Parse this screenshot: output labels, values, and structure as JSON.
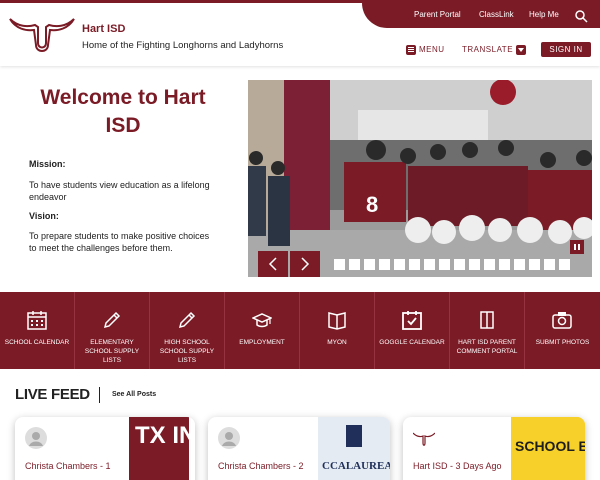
{
  "header": {
    "site_name": "Hart ISD",
    "tagline": "Home of the Fighting Longhorns and Ladyhorns",
    "top_links": [
      "Parent Portal",
      "ClassLink",
      "Help Me"
    ],
    "menu_label": "MENU",
    "translate_label": "TRANSLATE",
    "signin_label": "SIGN IN",
    "logo_icon": "longhorn-logo-icon",
    "search_icon": "search-icon"
  },
  "welcome": {
    "title": "Welcome to Hart ISD",
    "mission_heading": "Mission:",
    "mission_text": "To have students view education as a lifelong endeavor",
    "vision_heading": "Vision:",
    "vision_text": "To prepare students to make positive choices to meet the challenges before them."
  },
  "slideshow": {
    "slide_count": 16,
    "active_slide": 1
  },
  "quicklinks": [
    {
      "label": "SCHOOL CALENDAR",
      "icon": "calendar-icon"
    },
    {
      "label": "ELEMENTARY SCHOOL SUPPLY LISTS",
      "icon": "pencil-icon"
    },
    {
      "label": "HIGH SCHOOL SCHOOL SUPPLY LISTS",
      "icon": "pencil-icon"
    },
    {
      "label": "EMPLOYMENT",
      "icon": "graduation-cap-icon"
    },
    {
      "label": "MYON",
      "icon": "book-icon"
    },
    {
      "label": "GOGGLE CALENDAR",
      "icon": "calendar-check-icon"
    },
    {
      "label": "HART ISD PARENT COMMENT PORTAL",
      "icon": "open-book-icon"
    },
    {
      "label": "SUBMIT PHOTOS",
      "icon": "camera-icon"
    }
  ],
  "live_feed": {
    "title": "LIVE FEED",
    "see_all": "See All Posts",
    "cards": [
      {
        "author": "Christa Chambers - 1",
        "image_text": "TX ING"
      },
      {
        "author": "Christa Chambers - 2",
        "image_text": "CCALAUREA SERVICE"
      },
      {
        "author": "Hart ISD - 3 Days Ago",
        "image_text": "SCHOOL BUS VER"
      }
    ]
  },
  "colors": {
    "brand": "#7a1b26",
    "white": "#ffffff"
  }
}
